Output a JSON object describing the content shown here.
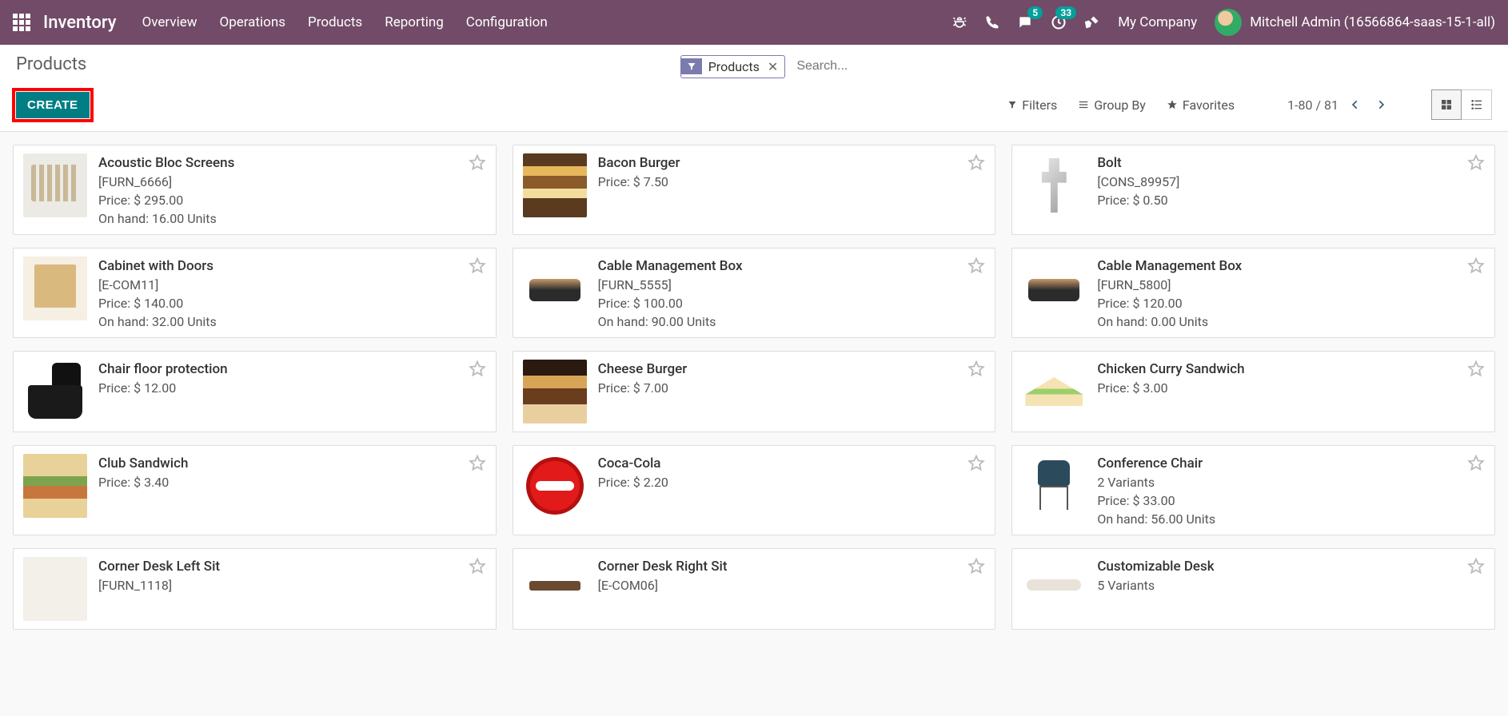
{
  "topbar": {
    "brand": "Inventory",
    "nav": [
      "Overview",
      "Operations",
      "Products",
      "Reporting",
      "Configuration"
    ],
    "messaging_badge": "5",
    "activities_badge": "33",
    "company": "My Company",
    "user": "Mitchell Admin (16566864-saas-15-1-all)"
  },
  "control_panel": {
    "breadcrumb": "Products",
    "create_label": "CREATE",
    "filter_pill": "Products",
    "search_placeholder": "Search...",
    "filters_label": "Filters",
    "groupby_label": "Group By",
    "favorites_label": "Favorites",
    "pager": "1-80 / 81"
  },
  "products": [
    {
      "name": "Acoustic Bloc Screens",
      "ref": "[FURN_6666]",
      "price": "Price: $ 295.00",
      "onhand": "On hand: 16.00 Units",
      "thumb": "thumb-screen"
    },
    {
      "name": "Bacon Burger",
      "ref": "",
      "price": "Price: $ 7.50",
      "onhand": "",
      "thumb": "thumb-burger"
    },
    {
      "name": "Bolt",
      "ref": "[CONS_89957]",
      "price": "Price: $ 0.50",
      "onhand": "",
      "thumb": "thumb-bolt"
    },
    {
      "name": "Cabinet with Doors",
      "ref": "[E-COM11]",
      "price": "Price: $ 140.00",
      "onhand": "On hand: 32.00 Units",
      "thumb": "thumb-cabinet"
    },
    {
      "name": "Cable Management Box",
      "ref": "[FURN_5555]",
      "price": "Price: $ 100.00",
      "onhand": "On hand: 90.00 Units",
      "thumb": "thumb-cablebox"
    },
    {
      "name": "Cable Management Box",
      "ref": "[FURN_5800]",
      "price": "Price: $ 120.00",
      "onhand": "On hand: 0.00 Units",
      "thumb": "thumb-cablebox"
    },
    {
      "name": "Chair floor protection",
      "ref": "",
      "price": "Price: $ 12.00",
      "onhand": "",
      "thumb": "thumb-chairmat"
    },
    {
      "name": "Cheese Burger",
      "ref": "",
      "price": "Price: $ 7.00",
      "onhand": "",
      "thumb": "thumb-cheese"
    },
    {
      "name": "Chicken Curry Sandwich",
      "ref": "",
      "price": "Price: $ 3.00",
      "onhand": "",
      "thumb": "thumb-sandwich"
    },
    {
      "name": "Club Sandwich",
      "ref": "",
      "price": "Price: $ 3.40",
      "onhand": "",
      "thumb": "thumb-club"
    },
    {
      "name": "Coca-Cola",
      "ref": "",
      "price": "Price: $ 2.20",
      "onhand": "",
      "thumb": "thumb-coke"
    },
    {
      "name": "Conference Chair",
      "ref": "2 Variants",
      "price": "Price: $ 33.00",
      "onhand": "On hand: 56.00 Units",
      "thumb": "thumb-chair"
    },
    {
      "name": "Corner Desk Left Sit",
      "ref": "[FURN_1118]",
      "price": "",
      "onhand": "",
      "thumb": "thumb-deskL"
    },
    {
      "name": "Corner Desk Right Sit",
      "ref": "[E-COM06]",
      "price": "",
      "onhand": "",
      "thumb": "thumb-deskR"
    },
    {
      "name": "Customizable Desk",
      "ref": "5 Variants",
      "price": "",
      "onhand": "",
      "thumb": "thumb-custdesk"
    }
  ]
}
